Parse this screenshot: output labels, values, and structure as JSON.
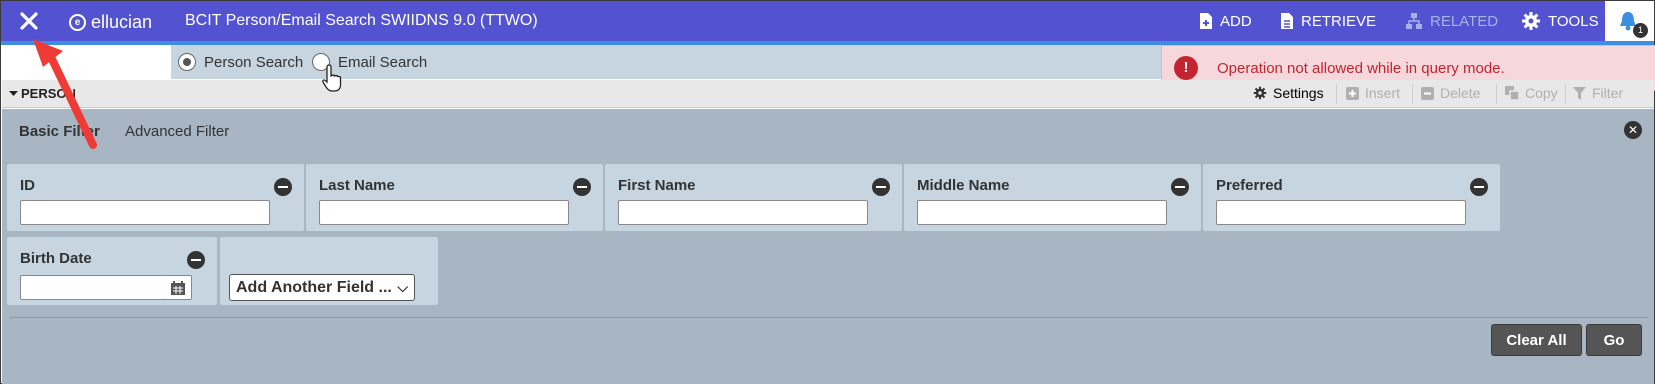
{
  "header": {
    "logo_text": "ellucian",
    "title": "BCIT Person/Email Search SWIIDNS 9.0 (TTWO)",
    "actions": {
      "add": "ADD",
      "retrieve": "RETRIEVE",
      "related": "RELATED",
      "tools": "TOOLS"
    },
    "notification_count": "1",
    "colors": {
      "bar": "#5353d1",
      "accent_strip": "#3c8fe0"
    }
  },
  "search_mode": {
    "options": [
      "Person Search",
      "Email Search"
    ],
    "selected": "Person Search"
  },
  "toast": {
    "icon": "!",
    "message": "Operation not allowed while in query mode.",
    "color": "#c4242f"
  },
  "section": {
    "title": "PERSON",
    "actions": {
      "settings": "Settings",
      "insert": "Insert",
      "delete": "Delete",
      "copy": "Copy",
      "filter": "Filter"
    }
  },
  "filter": {
    "tabs": [
      "Basic Filter",
      "Advanced Filter"
    ],
    "active_tab": "Basic Filter",
    "fields": {
      "id": {
        "label": "ID",
        "value": ""
      },
      "last_name": {
        "label": "Last Name",
        "value": ""
      },
      "first_name": {
        "label": "First Name",
        "value": ""
      },
      "middle_name": {
        "label": "Middle Name",
        "value": ""
      },
      "preferred": {
        "label": "Preferred",
        "value": ""
      },
      "birth_date": {
        "label": "Birth Date",
        "value": ""
      }
    },
    "add_field_label": "Add Another Field ...",
    "clear_all": "Clear All",
    "go": "Go"
  }
}
